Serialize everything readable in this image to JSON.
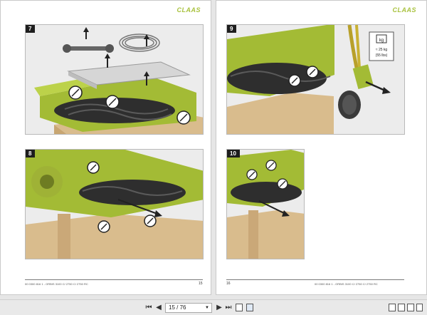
{
  "brand": "CLAAS",
  "pages": {
    "left": {
      "figures": [
        "7",
        "8"
      ],
      "footer_text": "00 0300 816 1 - ORBIS 3100 C/ 2750 C/ 2750 RC",
      "page_number": "15"
    },
    "right": {
      "figures": [
        "9",
        "10"
      ],
      "weight_label_kg": "kg",
      "weight_value": "≈ 25 kg",
      "weight_value_lbs": "(55 lbs)",
      "footer_text": "00 0300 816 1 - ORBIS 3100 C/ 2750 C/ 2750 RC",
      "page_number": "16"
    }
  },
  "toolbar": {
    "first_label": "⏮",
    "prev_label": "◀",
    "page_indicator": "15 / 76",
    "next_label": "▶",
    "last_label": "⏭",
    "icons": [
      "copy-page-icon",
      "fit-page-icon",
      "single-page-icon",
      "facing-pages-icon",
      "scroll-icon",
      "book-icon"
    ]
  },
  "colors": {
    "claas_green": "#a9c23f",
    "figure_bg": "#eaeaea",
    "wood": "#d8b98a",
    "dark": "#2d2d2d"
  }
}
